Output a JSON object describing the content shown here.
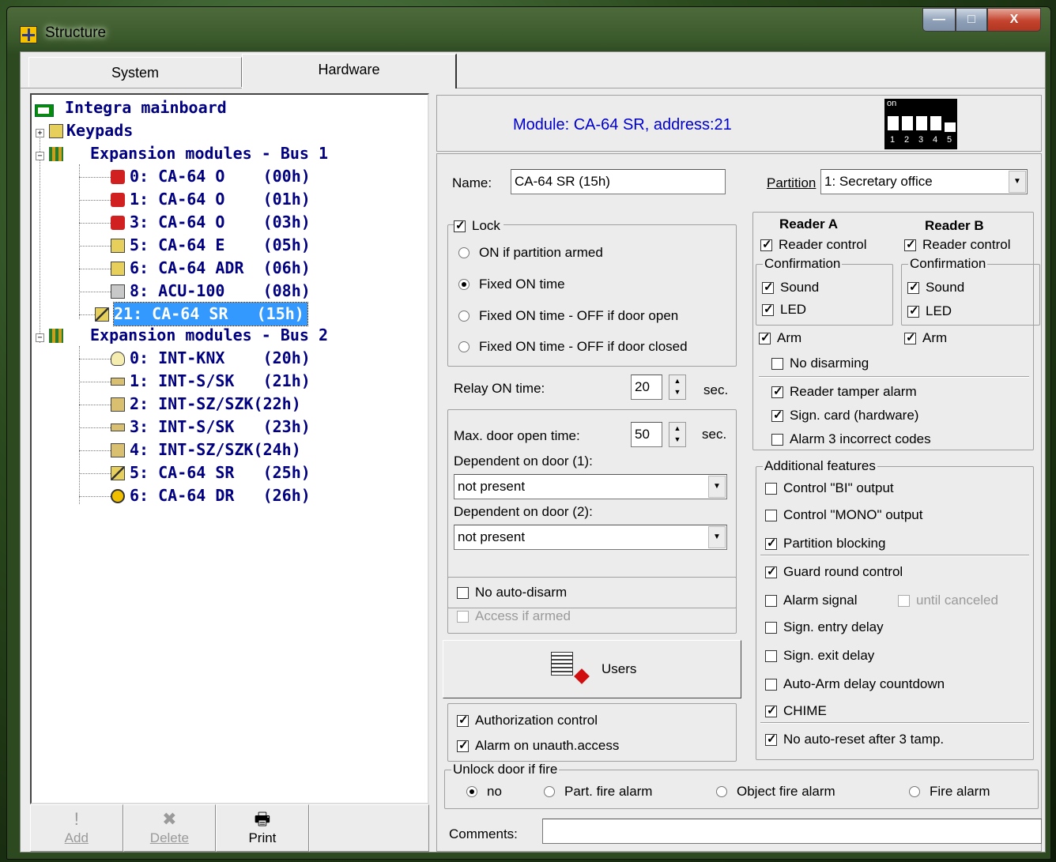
{
  "window": {
    "title": "Structure",
    "buttons": [
      "—",
      "□",
      "X"
    ]
  },
  "tabs": [
    {
      "label": "System",
      "active": false
    },
    {
      "label": "Hardware",
      "active": true
    }
  ],
  "tree": {
    "root": "Integra mainboard",
    "keypads": "Keypads",
    "bus1": {
      "label": "Expansion modules - Bus 1",
      "items": [
        {
          "label": "0: CA-64 O    (00h)"
        },
        {
          "label": "1: CA-64 O    (01h)"
        },
        {
          "label": "3: CA-64 O    (03h)"
        },
        {
          "label": "5: CA-64 E    (05h)"
        },
        {
          "label": "6: CA-64 ADR  (06h)"
        },
        {
          "label": "8: ACU-100    (08h)"
        },
        {
          "label": "21: CA-64 SR   (15h)",
          "selected": true
        }
      ]
    },
    "bus2": {
      "label": "Expansion modules - Bus 2",
      "items": [
        {
          "label": "0: INT-KNX    (20h)"
        },
        {
          "label": "1: INT-S/SK   (21h)"
        },
        {
          "label": "2: INT-SZ/SZK(22h)"
        },
        {
          "label": "3: INT-S/SK   (23h)"
        },
        {
          "label": "4: INT-SZ/SZK(24h)"
        },
        {
          "label": "5: CA-64 SR   (25h)"
        },
        {
          "label": "6: CA-64 DR   (26h)"
        }
      ]
    }
  },
  "left_buttons": {
    "add": "Add",
    "delete": "Delete",
    "print": "Print"
  },
  "module": {
    "header": "Module: CA-64 SR, address:21",
    "dip_on": "on",
    "dip_numbers": [
      "1",
      "2",
      "3",
      "4",
      "5"
    ],
    "name_label": "Name:",
    "name_value": "CA-64 SR  (15h)",
    "partition_label": "Partition",
    "partition_value": "1: Secretary office"
  },
  "lock": {
    "label": "Lock",
    "checked": true,
    "options": [
      {
        "label": "ON if partition armed",
        "selected": false
      },
      {
        "label": "Fixed ON time",
        "selected": true
      },
      {
        "label": "Fixed ON time - OFF if door open",
        "selected": false
      },
      {
        "label": "Fixed ON time - OFF if door closed",
        "selected": false
      }
    ]
  },
  "relay": {
    "label": "Relay ON time:",
    "value": "20",
    "unit": "sec."
  },
  "door": {
    "max_open_label": "Max. door open time:",
    "max_open_value": "50",
    "unit": "sec.",
    "dep1_label": "Dependent on door (1):",
    "dep1_value": "not present",
    "dep2_label": "Dependent on door (2):",
    "dep2_value": "not present"
  },
  "auto": {
    "no_auto_disarm": "No auto-disarm",
    "access_if_armed": "Access if armed"
  },
  "users_button": "Users",
  "auth": {
    "authorization_control": "Authorization control",
    "alarm_unauth": "Alarm on unauth.access"
  },
  "readers": {
    "a": {
      "title": "Reader A",
      "control": "Reader control",
      "confirmation": "Confirmation",
      "sound": "Sound",
      "led": "LED",
      "arm": "Arm"
    },
    "b": {
      "title": "Reader B",
      "control": "Reader control",
      "confirmation": "Confirmation",
      "sound": "Sound",
      "led": "LED",
      "arm": "Arm"
    },
    "no_disarming": "No disarming",
    "tamper_alarm": "Reader tamper alarm",
    "sign_card": "Sign. card (hardware)",
    "alarm3": "Alarm 3 incorrect codes"
  },
  "additional": {
    "legend": "Additional features",
    "control_bi": "Control \"BI\" output",
    "control_mono": "Control \"MONO\" output",
    "partition_blocking": "Partition blocking",
    "guard_round": "Guard round control",
    "alarm_signal": "Alarm signal",
    "until_canceled": "until canceled",
    "sign_entry": "Sign. entry delay",
    "sign_exit": "Sign. exit delay",
    "auto_arm": "Auto-Arm delay countdown",
    "chime": "CHIME",
    "no_auto_reset": "No auto-reset after 3 tamp."
  },
  "fire": {
    "legend": "Unlock door if fire",
    "options": [
      {
        "label": "no",
        "selected": true
      },
      {
        "label": "Part. fire alarm",
        "selected": false
      },
      {
        "label": "Object fire alarm",
        "selected": false
      },
      {
        "label": "Fire alarm",
        "selected": false
      }
    ]
  },
  "comments": {
    "label": "Comments:",
    "value": ""
  },
  "colors": {
    "tree_text": "#000080",
    "header_text": "#0000cc",
    "selection": "#3399ff"
  }
}
